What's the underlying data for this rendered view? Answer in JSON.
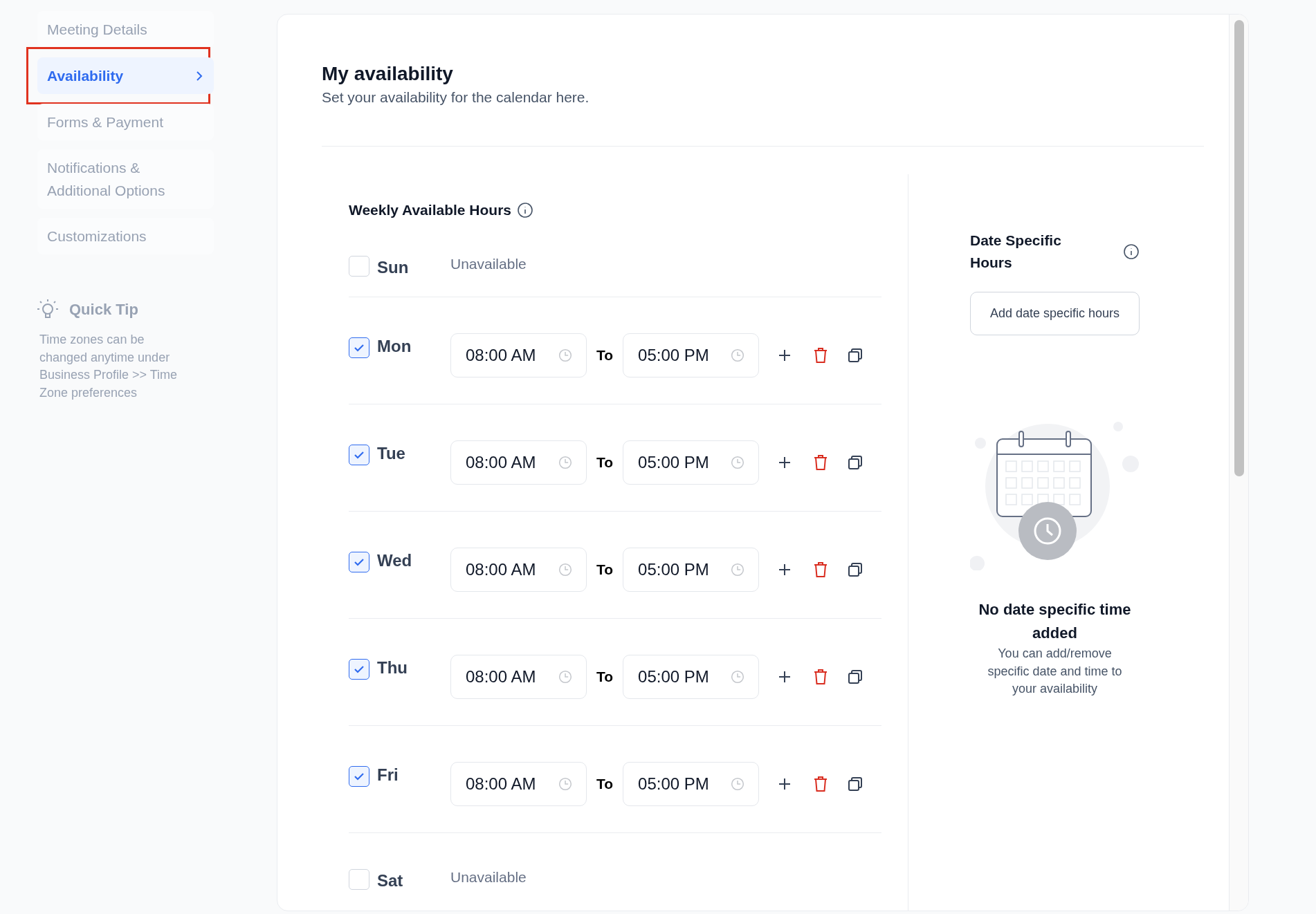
{
  "sidebar": {
    "items": [
      {
        "label": "Meeting Details",
        "selected": false
      },
      {
        "label": "Availability",
        "selected": true
      },
      {
        "label": "Forms & Payment",
        "selected": false
      },
      {
        "label": "Notifications & Additional Options",
        "selected": false
      },
      {
        "label": "Customizations",
        "selected": false
      }
    ],
    "quick_tip": {
      "title": "Quick Tip",
      "text": "Time zones can be changed anytime under Business Profile >> Time Zone preferences"
    }
  },
  "header": {
    "title": "My availability",
    "subtitle": "Set your availability for the calendar here."
  },
  "weekly": {
    "title": "Weekly Available Hours",
    "days": [
      {
        "day": "Sun",
        "checked": false,
        "status": "Unavailable"
      },
      {
        "day": "Mon",
        "checked": true,
        "start": "08:00 AM",
        "to": "To",
        "end": "05:00 PM"
      },
      {
        "day": "Tue",
        "checked": true,
        "start": "08:00 AM",
        "to": "To",
        "end": "05:00 PM"
      },
      {
        "day": "Wed",
        "checked": true,
        "start": "08:00 AM",
        "to": "To",
        "end": "05:00 PM"
      },
      {
        "day": "Thu",
        "checked": true,
        "start": "08:00 AM",
        "to": "To",
        "end": "05:00 PM"
      },
      {
        "day": "Fri",
        "checked": true,
        "start": "08:00 AM",
        "to": "To",
        "end": "05:00 PM"
      },
      {
        "day": "Sat",
        "checked": false,
        "status": "Unavailable"
      }
    ]
  },
  "date_specific": {
    "title": "Date Specific Hours",
    "button": "Add date specific hours",
    "empty_title": "No date specific time added",
    "empty_text": "You can add/remove specific date and time to your availability"
  }
}
